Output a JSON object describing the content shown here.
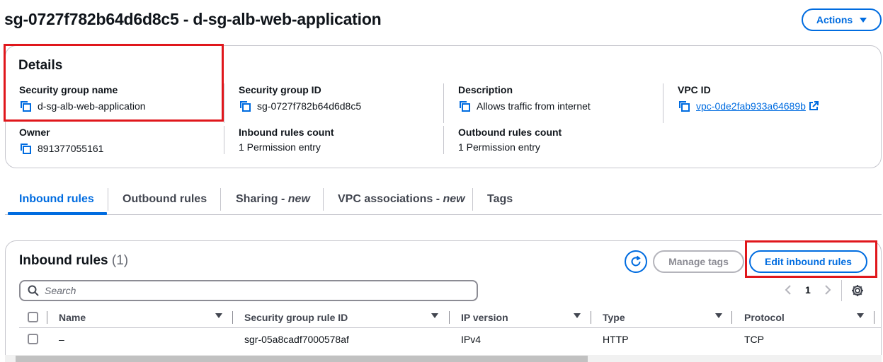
{
  "page": {
    "title": "sg-0727f782b64d6d8c5 - d-sg-alb-web-application",
    "actions_label": "Actions"
  },
  "details": {
    "title": "Details",
    "security_group_name": {
      "label": "Security group name",
      "value": "d-sg-alb-web-application"
    },
    "security_group_id": {
      "label": "Security group ID",
      "value": "sg-0727f782b64d6d8c5"
    },
    "description": {
      "label": "Description",
      "value": "Allows traffic from internet"
    },
    "vpc_id": {
      "label": "VPC ID",
      "value": "vpc-0de2fab933a64689b"
    },
    "owner": {
      "label": "Owner",
      "value": "891377055161"
    },
    "inbound_rules_count": {
      "label": "Inbound rules count",
      "value": "1 Permission entry"
    },
    "outbound_rules_count": {
      "label": "Outbound rules count",
      "value": "1 Permission entry"
    }
  },
  "tabs": [
    {
      "label": "Inbound rules",
      "suffix": "",
      "active": true
    },
    {
      "label": "Outbound rules",
      "suffix": "",
      "active": false
    },
    {
      "label": "Sharing - ",
      "suffix": "new",
      "active": false
    },
    {
      "label": "VPC associations - ",
      "suffix": "new",
      "active": false
    },
    {
      "label": "Tags",
      "suffix": "",
      "active": false
    }
  ],
  "inbound": {
    "title": "Inbound rules",
    "count": "(1)",
    "manage_tags_label": "Manage tags",
    "edit_label": "Edit inbound rules",
    "search_placeholder": "Search",
    "page_number": "1",
    "columns": [
      "Name",
      "Security group rule ID",
      "IP version",
      "Type",
      "Protocol"
    ],
    "rows": [
      {
        "name": "–",
        "rule_id": "sgr-05a8cadf7000578af",
        "ip_version": "IPv4",
        "type": "HTTP",
        "protocol": "TCP"
      }
    ]
  },
  "colors": {
    "accent": "#006ce0",
    "highlight": "#e0171c",
    "border": "#c6c6cd",
    "text": "#0f141a"
  },
  "icons": [
    "copy-icon",
    "external-link-icon",
    "refresh-icon",
    "search-icon",
    "chevron-left-icon",
    "chevron-right-icon",
    "settings-gear-icon",
    "sort-caret-icon"
  ]
}
